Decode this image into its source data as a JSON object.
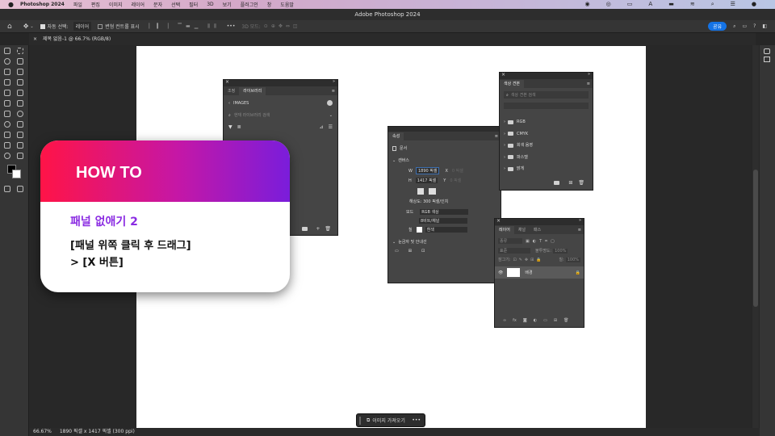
{
  "menubar": {
    "app_name": "Photoshop 2024",
    "items": [
      "파일",
      "편집",
      "이미지",
      "레이어",
      "문자",
      "선택",
      "필터",
      "3D",
      "보기",
      "플러그인",
      "창",
      "도움말"
    ]
  },
  "window": {
    "title": "Adobe Photoshop 2024"
  },
  "options": {
    "auto_select_label": "자동 선택:",
    "auto_select_value": "레이어",
    "transform_label": "변형 컨트롤 표시",
    "mode_3d": "3D 모드:",
    "share_label": "공유"
  },
  "document_tab": {
    "title": "제목 없음-1 @ 66.7% (RGB/8)"
  },
  "status": {
    "zoom": "66.67%",
    "info": "1890 픽셀 x 1417 픽셀 (300 ppi)"
  },
  "libraries_panel": {
    "tabs": [
      "조정",
      "라이브러리"
    ],
    "breadcrumb": "IMAGES",
    "search_placeholder": "현재 라이브러리 검색"
  },
  "properties_panel": {
    "tab": "속성",
    "doc_label": "문서",
    "canvas_section": "캔버스",
    "w_label": "W",
    "w_value": "1890 픽셀",
    "h_label": "H",
    "h_value": "1417 픽셀",
    "x_label": "X",
    "y_label": "Y",
    "x_placeholder": "0 픽셀",
    "y_placeholder": "0 픽셀",
    "resolution": "해상도: 300 픽셀/인치",
    "mode_label": "모드",
    "mode_value": "RGB 색상",
    "depth_value": "8비트/채널",
    "fill_label": "칠",
    "fill_value": "흰색",
    "rulers_section": "눈금자 및 안내선"
  },
  "swatches_panel": {
    "tab": "색상 견본",
    "search_placeholder": "색상 견본 검색",
    "folders": [
      "RGB",
      "CMYK",
      "회색 음영",
      "파스텔",
      "밝게"
    ]
  },
  "layers_panel": {
    "tabs": [
      "레이어",
      "채널",
      "패스"
    ],
    "kind_placeholder": "종류",
    "blend_mode": "표준",
    "opacity_label": "불투명도:",
    "opacity_value": "100%",
    "lock_label": "잠그기:",
    "fill_label": "칠:",
    "fill_value": "100%",
    "layer_name": "배경"
  },
  "card": {
    "title": "HOW TO",
    "subtitle": "패널 없애기 2",
    "line1": "[패널 위쪽 클릭 후 드래그]",
    "line2": "> [X 버튼]"
  },
  "float_bar": {
    "label": "이미지 가져오기"
  },
  "colors": {
    "card_gradient_start": "#ff1447",
    "card_gradient_end": "#7a1ddb",
    "subtitle_color": "#8a2be2",
    "share_button": "#1473e6"
  }
}
